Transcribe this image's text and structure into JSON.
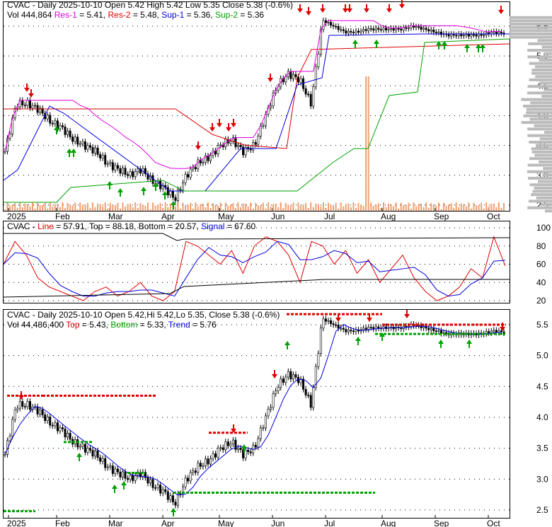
{
  "ticker": "CVAC",
  "panel1": {
    "line1": "CVAC - Daily 2025-10-10 Open 5.42  High 5.42  Low 5.35  Close 5.38 (-0.6%)",
    "vol": "Vol 444,864",
    "res1_label": "Res-1",
    "res1": "= 5.41,",
    "res2_label": "Res-2",
    "res2": "= 5.48,",
    "sup1_label": "Sup-1",
    "sup1": "= 5.36,",
    "sup2_label": "Sup-2",
    "sup2": "= 5.36"
  },
  "panel2": {
    "prefix": "CVAC -",
    "line_label": "Line",
    "line": "= 57.91, Top = 88.18, Bottom = 20.57,",
    "signal_label": "Signal",
    "signal": "= 67.60"
  },
  "panel3": {
    "line1": "CVAC - Daily 2025-10-10 Open 5.42,Hi 5.42,Lo 5.35, Close 5.38 (-0.6%)",
    "vol": "Vol 44,486,400",
    "top_label": "Top",
    "top": "= 5.43,",
    "bottom_label": "Bottom",
    "bottom": "= 5.33,",
    "trend_label": "Trend",
    "trend": "= 5.76"
  },
  "colors": {
    "up": "#000000",
    "res1": "#e000e0",
    "res2": "#e00000",
    "sup1": "#0000e0",
    "sup2": "#00a000",
    "sell": "#e00000",
    "buy": "#00a000"
  },
  "chart_data": {
    "type": "candlestick",
    "x_labels": [
      "2025",
      "Feb",
      "Mar",
      "Apr",
      "May",
      "Jun",
      "Jul",
      "Aug",
      "Sep",
      "Oct"
    ],
    "price_ticks_top": [
      "5.5",
      "5.0",
      "4.5",
      "4.0",
      "3.5",
      "3.0",
      "2.5"
    ],
    "price_ticks_bottom": [
      "5.5",
      "5.0",
      "4.5",
      "4.0",
      "3.5",
      "3.0",
      "2.5"
    ],
    "osc_ticks": [
      "100",
      "80",
      "60",
      "40",
      "20"
    ],
    "close_weekly": [
      3.4,
      4.2,
      4.2,
      4.1,
      3.9,
      3.8,
      3.6,
      3.5,
      3.4,
      3.2,
      3.1,
      3.0,
      3.1,
      2.9,
      2.8,
      2.6,
      3.0,
      3.2,
      3.3,
      3.5,
      3.6,
      3.4,
      3.5,
      4.0,
      4.5,
      4.7,
      4.6,
      4.2,
      5.6,
      5.5,
      5.4,
      5.4,
      5.45,
      5.45,
      5.45,
      5.45,
      5.5,
      5.45,
      5.4,
      5.35,
      5.35,
      5.35,
      5.35,
      5.4,
      5.38
    ],
    "oscillator_weekly": [
      60,
      85,
      70,
      45,
      35,
      30,
      25,
      20,
      30,
      35,
      25,
      30,
      40,
      25,
      20,
      30,
      85,
      80,
      70,
      60,
      75,
      50,
      80,
      90,
      85,
      70,
      40,
      85,
      80,
      60,
      75,
      50,
      65,
      40,
      55,
      70,
      45,
      30,
      20,
      25,
      35,
      55,
      45,
      90,
      58
    ],
    "ylim_price": [
      2.4,
      5.7
    ],
    "ylim_osc": [
      10,
      105
    ]
  }
}
